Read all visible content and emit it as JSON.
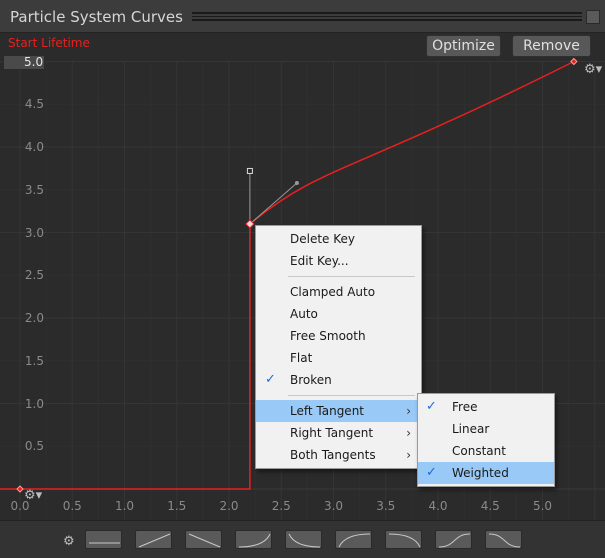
{
  "window": {
    "title": "Particle System Curves"
  },
  "toolbar": {
    "optimize_label": "Optimize",
    "remove_label": "Remove"
  },
  "curve": {
    "name": "Start Lifetime",
    "max_value": "5.0",
    "color": "#e8201f",
    "keys": [
      {
        "time": 0.0,
        "value": 0.0
      },
      {
        "time": 2.2,
        "value": 3.1,
        "selected": true,
        "left_tangent": "Weighted",
        "broken": true
      },
      {
        "time": 5.3,
        "value": 5.0
      }
    ]
  },
  "axes": {
    "y_ticks": [
      "5.0",
      "4.5",
      "4.0",
      "3.5",
      "3.0",
      "2.5",
      "2.0",
      "1.5",
      "1.0",
      "0.5",
      "0.0"
    ],
    "x_ticks": [
      "0.0",
      "0.5",
      "1.0",
      "1.5",
      "2.0",
      "2.5",
      "3.0",
      "3.5",
      "4.0",
      "4.5",
      "5.0"
    ]
  },
  "context_menu": {
    "items": [
      {
        "label": "Delete Key"
      },
      {
        "label": "Edit Key..."
      },
      {
        "separator": true
      },
      {
        "label": "Clamped Auto"
      },
      {
        "label": "Auto"
      },
      {
        "label": "Free Smooth"
      },
      {
        "label": "Flat"
      },
      {
        "label": "Broken",
        "checked": true
      },
      {
        "separator": true
      },
      {
        "label": "Left Tangent",
        "submenu": true,
        "highlighted": true
      },
      {
        "label": "Right Tangent",
        "submenu": true
      },
      {
        "label": "Both Tangents",
        "submenu": true
      }
    ]
  },
  "submenu": {
    "items": [
      {
        "label": "Free",
        "checked": true
      },
      {
        "label": "Linear"
      },
      {
        "label": "Constant"
      },
      {
        "label": "Weighted",
        "checked": true,
        "highlighted": true
      }
    ]
  },
  "presets": {
    "count": 9,
    "settings_icon": "gear-icon"
  }
}
